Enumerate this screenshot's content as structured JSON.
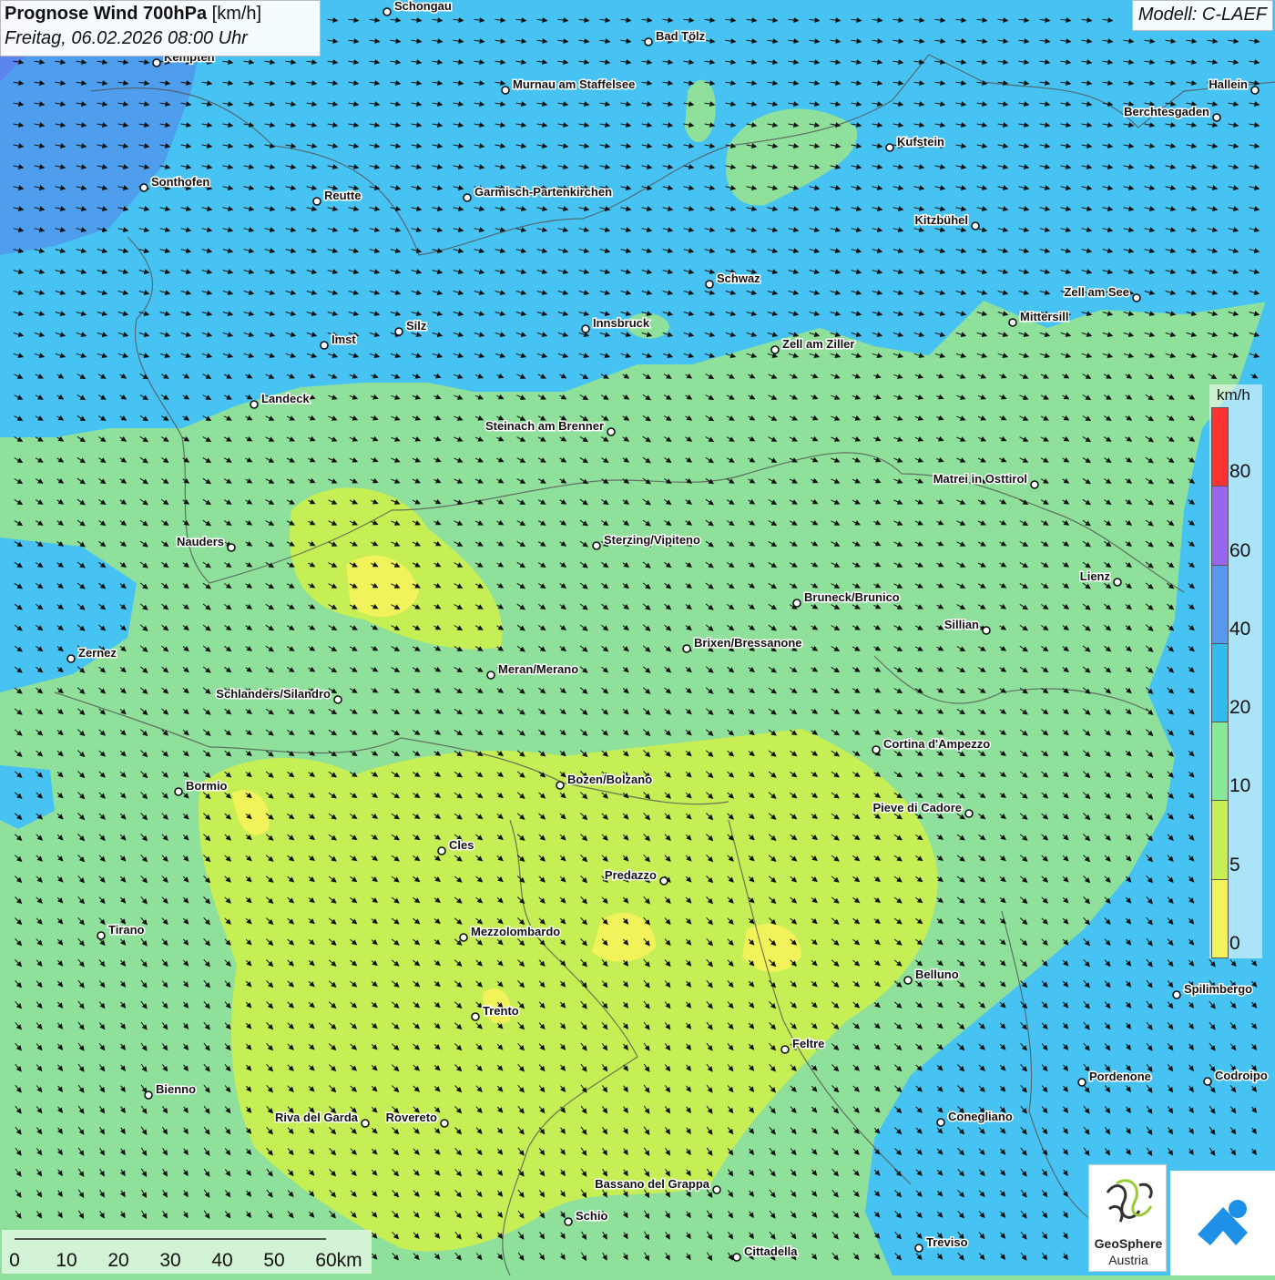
{
  "header": {
    "title_bold": "Prognose Wind 700hPa",
    "title_unit": "[km/h]",
    "datetime": "Freitag, 06.02.2026 08:00 Uhr",
    "model": "Modell: C-LAEF"
  },
  "legend": {
    "unit": "km/h",
    "ticks": [
      "80",
      "60",
      "40",
      "20",
      "10",
      "5",
      "0"
    ],
    "colors": [
      "#ff3232",
      "#9966ee",
      "#5599ee",
      "#33bbee",
      "#88e899",
      "#c6ee55",
      "#f2f35a"
    ]
  },
  "scalebar": {
    "labels": [
      "0",
      "10",
      "20",
      "30",
      "40",
      "50",
      "60km"
    ]
  },
  "logo": {
    "line1": "GeoSphere",
    "line2": "Austria"
  },
  "cities": [
    {
      "name": "Schongau"
    },
    {
      "name": "Bad Tölz"
    },
    {
      "name": "Kempten"
    },
    {
      "name": "Murnau am Staffelsee"
    },
    {
      "name": "Hallein"
    },
    {
      "name": "Berchtesgaden"
    },
    {
      "name": "Kufstein"
    },
    {
      "name": "Sonthofen"
    },
    {
      "name": "Reutte"
    },
    {
      "name": "Garmisch-Partenkirchen"
    },
    {
      "name": "Kitzbühel"
    },
    {
      "name": "Schwaz"
    },
    {
      "name": "Zell am See"
    },
    {
      "name": "Mittersill"
    },
    {
      "name": "Innsbruck"
    },
    {
      "name": "Silz"
    },
    {
      "name": "Imst"
    },
    {
      "name": "Zell am Ziller"
    },
    {
      "name": "Landeck"
    },
    {
      "name": "Steinach am Brenner"
    },
    {
      "name": "Matrei in Osttirol"
    },
    {
      "name": "Nauders"
    },
    {
      "name": "Sterzing/Vipiteno"
    },
    {
      "name": "Lienz"
    },
    {
      "name": "Bruneck/Brunico"
    },
    {
      "name": "Sillian"
    },
    {
      "name": "Brixen/Bressanone"
    },
    {
      "name": "Zernez"
    },
    {
      "name": "Meran/Merano"
    },
    {
      "name": "Schlanders/Silandro"
    },
    {
      "name": "Cortina d'Ampezzo"
    },
    {
      "name": "Bozen/Bolzano"
    },
    {
      "name": "Bormio"
    },
    {
      "name": "Pieve di Cadore"
    },
    {
      "name": "Cles"
    },
    {
      "name": "Predazzo"
    },
    {
      "name": "Tirano"
    },
    {
      "name": "Mezzolombardo"
    },
    {
      "name": "Belluno"
    },
    {
      "name": "Spilimbergo"
    },
    {
      "name": "Trento"
    },
    {
      "name": "Feltre"
    },
    {
      "name": "Bienno"
    },
    {
      "name": "Pordenone"
    },
    {
      "name": "Codroipo"
    },
    {
      "name": "Riva del Garda"
    },
    {
      "name": "Rovereto"
    },
    {
      "name": "Conegliano"
    },
    {
      "name": "Bassano del Grappa"
    },
    {
      "name": "Schio"
    },
    {
      "name": "Treviso"
    },
    {
      "name": "Cittadella"
    }
  ]
}
